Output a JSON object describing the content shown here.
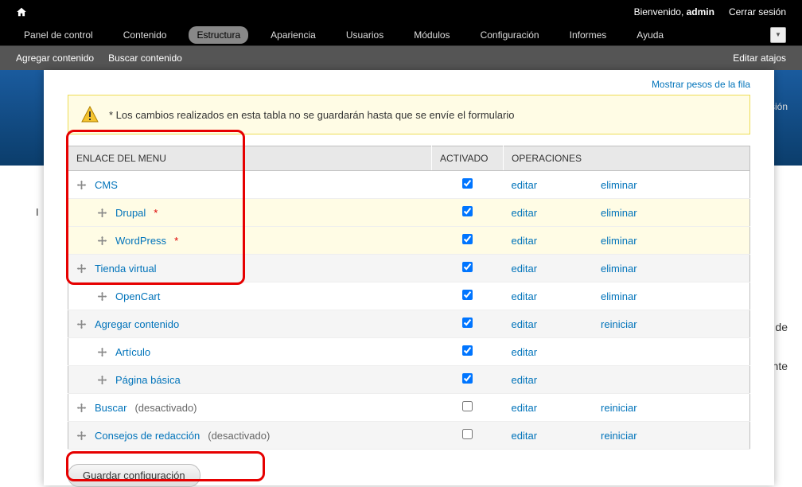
{
  "toolbar": {
    "welcome_prefix": "Bienvenido, ",
    "username": "admin",
    "logout": "Cerrar sesión"
  },
  "menubar": {
    "items": [
      {
        "label": "Panel de control"
      },
      {
        "label": "Contenido"
      },
      {
        "label": "Estructura",
        "active": true
      },
      {
        "label": "Apariencia"
      },
      {
        "label": "Usuarios"
      },
      {
        "label": "Módulos"
      },
      {
        "label": "Configuración"
      },
      {
        "label": "Informes"
      },
      {
        "label": "Ayuda"
      }
    ]
  },
  "shortcuts": {
    "add": "Agregar contenido",
    "find": "Buscar contenido",
    "edit": "Editar atajos"
  },
  "overlay": {
    "show_weights": "Mostrar pesos de la fila",
    "warning": "* Los cambios realizados en esta tabla no se guardarán hasta que se envíe el formulario",
    "columns": {
      "link": "ENLACE DEL MENU",
      "enabled": "ACTIVADO",
      "ops": "OPERACIONES"
    },
    "rows": [
      {
        "label": "CMS",
        "indent": 0,
        "checked": true,
        "edit": "editar",
        "op2": "eliminar",
        "changed": false
      },
      {
        "label": "Drupal",
        "indent": 1,
        "changed_mark": "*",
        "checked": true,
        "edit": "editar",
        "op2": "eliminar",
        "changed": true
      },
      {
        "label": "WordPress",
        "indent": 1,
        "changed_mark": "*",
        "checked": true,
        "edit": "editar",
        "op2": "eliminar",
        "changed": true
      },
      {
        "label": "Tienda virtual",
        "indent": 0,
        "checked": true,
        "edit": "editar",
        "op2": "eliminar",
        "changed": false
      },
      {
        "label": "OpenCart",
        "indent": 1,
        "checked": true,
        "edit": "editar",
        "op2": "eliminar",
        "changed": false
      },
      {
        "label": "Agregar contenido",
        "indent": 0,
        "checked": true,
        "edit": "editar",
        "op2": "reiniciar",
        "changed": false
      },
      {
        "label": "Artículo",
        "indent": 1,
        "checked": true,
        "edit": "editar",
        "op2": "",
        "changed": false
      },
      {
        "label": "Página básica",
        "indent": 1,
        "checked": true,
        "edit": "editar",
        "op2": "",
        "changed": false
      },
      {
        "label": "Buscar",
        "suffix": " (desactivado)",
        "indent": 0,
        "checked": false,
        "edit": "editar",
        "op2": "reiniciar",
        "changed": false
      },
      {
        "label": "Consejos de redacción",
        "suffix": " (desactivado)",
        "indent": 0,
        "checked": false,
        "edit": "editar",
        "op2": "reiniciar",
        "changed": false
      }
    ],
    "submit": "Guardar configuración"
  },
  "bg": {
    "i": "I",
    "r1": "de",
    "r2": "ente",
    "session": "r sesión"
  }
}
